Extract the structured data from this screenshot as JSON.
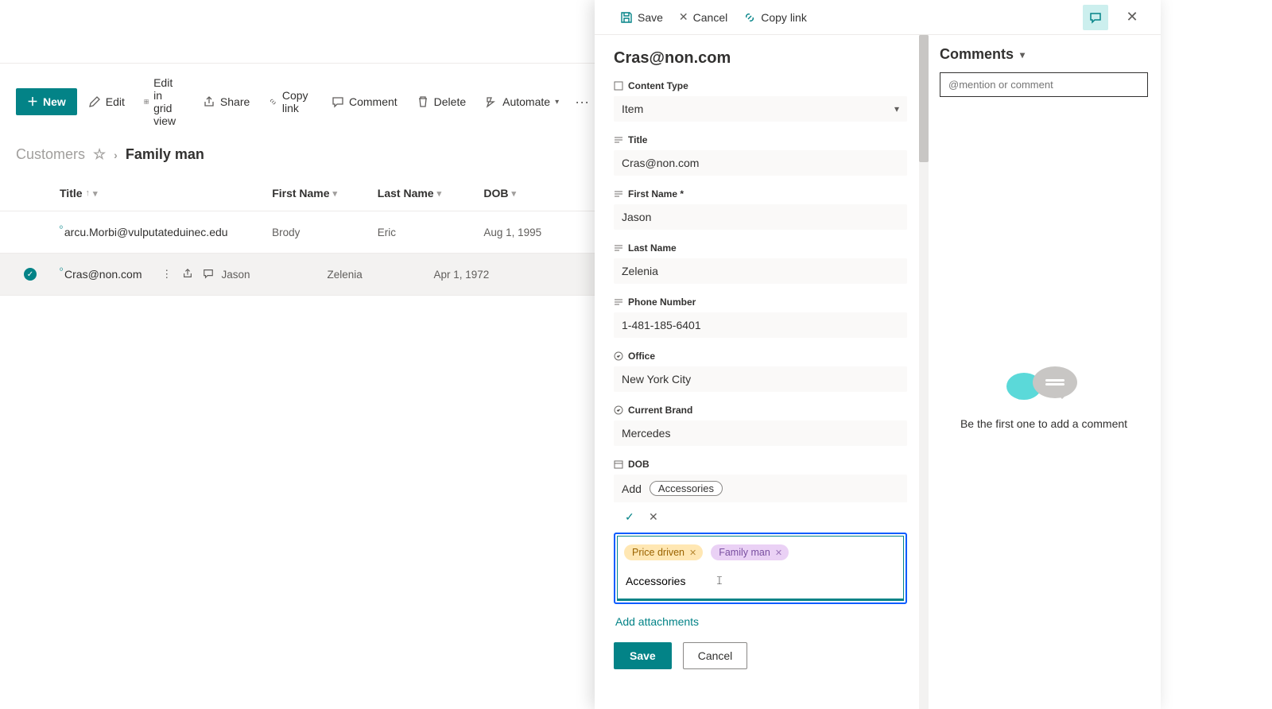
{
  "toolbar": {
    "new_label": "New",
    "edit_label": "Edit",
    "edit_grid_label": "Edit in grid view",
    "share_label": "Share",
    "copy_link_label": "Copy link",
    "comment_label": "Comment",
    "delete_label": "Delete",
    "automate_label": "Automate"
  },
  "breadcrumb": {
    "root": "Customers",
    "current": "Family man"
  },
  "columns": {
    "title": "Title",
    "first_name": "First Name",
    "last_name": "Last Name",
    "dob": "DOB"
  },
  "rows": [
    {
      "title": "arcu.Morbi@vulputateduinec.edu",
      "first_name": "Brody",
      "last_name": "Eric",
      "dob": "Aug 1, 1995",
      "selected": false
    },
    {
      "title": "Cras@non.com",
      "first_name": "Jason",
      "last_name": "Zelenia",
      "dob": "Apr 1, 1972",
      "selected": true
    }
  ],
  "panel": {
    "actions": {
      "save": "Save",
      "cancel": "Cancel",
      "copy_link": "Copy link"
    },
    "title": "Cras@non.com",
    "fields": {
      "content_type": {
        "label": "Content Type",
        "value": "Item"
      },
      "title": {
        "label": "Title",
        "value": "Cras@non.com"
      },
      "first_name": {
        "label": "First Name *",
        "value": "Jason"
      },
      "last_name": {
        "label": "Last Name",
        "value": "Zelenia"
      },
      "phone": {
        "label": "Phone Number",
        "value": "1-481-185-6401"
      },
      "office": {
        "label": "Office",
        "value": "New York City"
      },
      "brand": {
        "label": "Current Brand",
        "value": "Mercedes"
      },
      "dob": {
        "label": "DOB"
      }
    },
    "tag_editor": {
      "add_label": "Add",
      "suggestion": "Accessories",
      "tags": [
        {
          "name": "Price driven",
          "kind": "price"
        },
        {
          "name": "Family man",
          "kind": "family"
        }
      ],
      "input_value": "Accessories"
    },
    "add_attachments": "Add attachments",
    "buttons": {
      "save": "Save",
      "cancel": "Cancel"
    }
  },
  "comments": {
    "heading": "Comments",
    "placeholder": "@mention or comment",
    "empty": "Be the first one to add a comment"
  }
}
